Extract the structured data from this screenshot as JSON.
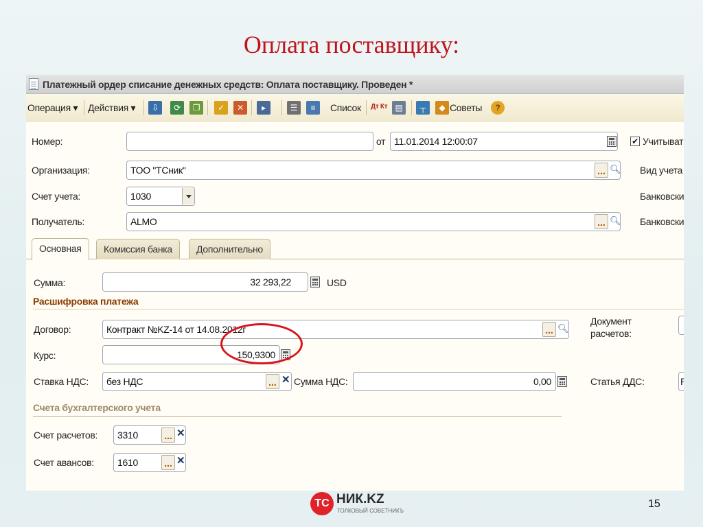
{
  "slide": {
    "title": "Оплата поставщику:",
    "page_number": "15",
    "logo": {
      "mark": "ТС",
      "text": "НИК.KZ",
      "tagline": "ТОЛКОВЫЙ СОВЕТНИКЪ",
      "color": "#e0232b"
    }
  },
  "window": {
    "title": "Платежный ордер списание денежных средств: Оплата поставщику. Проведен *",
    "toolbar": {
      "operation": "Операция ▾",
      "actions": "Действия ▾",
      "list": "Список",
      "dt_kt": "Дт Кт",
      "tips": "Советы"
    },
    "header": {
      "number_label": "Номер:",
      "number_value": "",
      "date_from_label": "от",
      "date_value": "11.01.2014 12:00:07",
      "consider_label": "Учитыват",
      "consider_checked": "✔",
      "org_label": "Организация:",
      "org_value": "ТОО \"ТСник\"",
      "accounting_type_label": "Вид учета",
      "account_label": "Счет учета:",
      "account_value": "1030",
      "bank_label_1": "Банковски",
      "recipient_label": "Получатель:",
      "recipient_value": "ALMO",
      "bank_label_2": "Банковски"
    },
    "tabs": [
      {
        "label": "Основная",
        "active": true
      },
      {
        "label": "Комиссия банка",
        "active": false
      },
      {
        "label": "Дополнительно",
        "active": false
      }
    ],
    "main": {
      "sum_label": "Сумма:",
      "sum_value": "32 293,22",
      "currency": "USD",
      "decoding_title": "Расшифровка платежа",
      "contract_label": "Договор:",
      "contract_value": "Контракт №KZ-14 от 14.08.2012г",
      "settlement_doc_label_1": "Документ",
      "settlement_doc_label_2": "расчетов:",
      "rate_label": "Курс:",
      "rate_value": "150,9300",
      "vat_rate_label": "Ставка НДС:",
      "vat_rate_value": "без НДС",
      "vat_sum_label": "Сумма НДС:",
      "vat_sum_value": "0,00",
      "cash_flow_label": "Статья ДДС:",
      "cash_flow_value": "Р",
      "accounts_title": "Счета бухгалтерского учета",
      "settlement_account_label": "Счет расчетов:",
      "settlement_account_value": "3310",
      "advance_account_label": "Счет авансов:",
      "advance_account_value": "1610"
    },
    "colors": {
      "accent_red": "#d8141b",
      "section_title": "#8a3b00",
      "section_muted": "#a08a6a"
    }
  }
}
